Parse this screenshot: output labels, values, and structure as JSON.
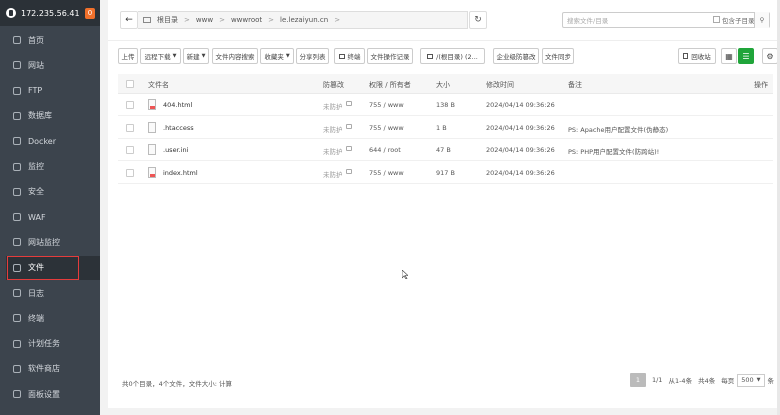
{
  "sidebar": {
    "server_ip": "172.235.56.41",
    "badge": "0",
    "items": [
      {
        "label": "首页",
        "icon": "home-icon"
      },
      {
        "label": "网站",
        "icon": "globe-icon"
      },
      {
        "label": "FTP",
        "icon": "ftp-icon"
      },
      {
        "label": "数据库",
        "icon": "database-icon"
      },
      {
        "label": "Docker",
        "icon": "docker-icon"
      },
      {
        "label": "监控",
        "icon": "monitor-icon"
      },
      {
        "label": "安全",
        "icon": "shield-icon"
      },
      {
        "label": "WAF",
        "icon": "waf-icon"
      },
      {
        "label": "网站监控",
        "icon": "chart-icon"
      },
      {
        "label": "文件",
        "icon": "folder-icon"
      },
      {
        "label": "日志",
        "icon": "log-icon"
      },
      {
        "label": "终端",
        "icon": "terminal-icon"
      },
      {
        "label": "计划任务",
        "icon": "clock-icon"
      },
      {
        "label": "软件商店",
        "icon": "store-icon"
      },
      {
        "label": "面板设置",
        "icon": "settings-icon"
      }
    ],
    "active_index": 9
  },
  "breadcrumb": [
    "根目录",
    "www",
    "wwwroot",
    "le.lezaiyun.cn"
  ],
  "search": {
    "placeholder": "搜索文件/目录",
    "include_subdir": "包含子目录"
  },
  "toolbar": {
    "upload": "上传",
    "remote_download": "远程下载",
    "new": "新建",
    "content_search": "文件内容搜索",
    "favorites": "收藏夹",
    "share_list": "分享列表",
    "terminal": "终端",
    "file_ops_log": "文件操作记录",
    "disk": "/(根目录) (2...",
    "tamper_proof": "企业级防篡改",
    "file_sync": "文件同步",
    "recycle_bin": "回收站"
  },
  "table": {
    "headers": [
      "文件名",
      "防篡改",
      "权限 / 所有者",
      "大小",
      "修改时间",
      "备注",
      "操作"
    ],
    "rows": [
      {
        "name": "404.html",
        "protect": "未防护",
        "perm": "755 / www",
        "size": "138 B",
        "mtime": "2024/04/14 09:36:26",
        "note": "",
        "type": "html"
      },
      {
        "name": ".htaccess",
        "protect": "未防护",
        "perm": "755 / www",
        "size": "1 B",
        "mtime": "2024/04/14 09:36:26",
        "note": "PS: Apache用户配置文件(伪静态)",
        "type": "file"
      },
      {
        "name": ".user.ini",
        "protect": "未防护",
        "perm": "644 / root",
        "size": "47 B",
        "mtime": "2024/04/14 09:36:26",
        "note": "PS: PHP用户配置文件(防跨站)!",
        "type": "file"
      },
      {
        "name": "index.html",
        "protect": "未防护",
        "perm": "755 / www",
        "size": "917 B",
        "mtime": "2024/04/14 09:36:26",
        "note": "",
        "type": "html"
      }
    ]
  },
  "footer": {
    "summary": "共0个目录，4个文件，文件大小: 计算",
    "page_current": "1",
    "page_total": "1/1",
    "range": "从1-4条",
    "total": "共4条",
    "per_page_label": "每页",
    "per_page": "500",
    "per_page_unit": "条"
  }
}
